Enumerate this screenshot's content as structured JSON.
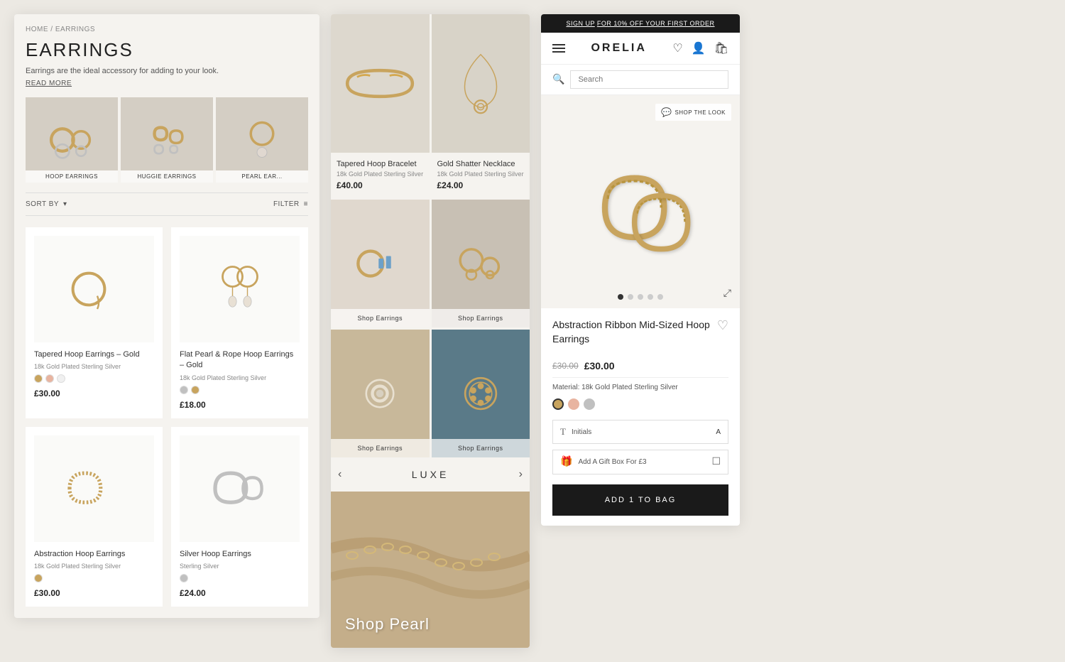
{
  "screen1": {
    "breadcrumb": "HOME / EARRINGS",
    "title": "EARRINGS",
    "description": "Earrings are the ideal accessory for adding to your look.",
    "read_more": "READ MORE",
    "categories": [
      {
        "label": "HOOP EARRINGS"
      },
      {
        "label": "HUGGIE EARRINGS"
      },
      {
        "label": "PEARL EAR..."
      }
    ],
    "sort_label": "SORT BY",
    "filter_label": "FILTER",
    "products": [
      {
        "name": "Tapered Hoop Earrings – Gold",
        "material": "18k Gold Plated Sterling Silver",
        "price": "£30.00",
        "swatches": [
          "gold",
          "rose",
          "white"
        ]
      },
      {
        "name": "Flat Pearl & Rope Hoop Earrings – Gold",
        "material": "18k Gold Plated Sterling Silver",
        "price": "£18.00",
        "swatches": [
          "silver",
          "gold"
        ]
      },
      {
        "name": "Abstraction Hoop Earrings",
        "material": "18k Gold Plated Sterling Silver",
        "price": "£30.00",
        "swatches": [
          "gold"
        ]
      },
      {
        "name": "Silver Hoop Earrings",
        "material": "Sterling Silver",
        "price": "£24.00",
        "swatches": [
          "silver"
        ]
      }
    ]
  },
  "screen2": {
    "featured_top_left": {
      "name": "Tapered Hoop Bracelet",
      "material": "18k Gold Plated Sterling Silver",
      "price": "£40.00"
    },
    "featured_top_right": {
      "name": "Gold Shatter Necklace",
      "material": "18k Gold Plated Sterling Silver",
      "price": "£24.00"
    },
    "grid_items": [
      {
        "label": "Shop Earrings"
      },
      {
        "label": "Shop Earrings"
      },
      {
        "label": "Shop Earrings"
      },
      {
        "label": "Shop Earrings"
      }
    ],
    "banner": {
      "title": "LUXE",
      "nav_left": "‹",
      "nav_right": "›"
    },
    "shop_pearl": {
      "label": "Shop Pearl"
    }
  },
  "screen3": {
    "promo": {
      "text": "FOR 10% OFF YOUR FIRST ORDER",
      "link": "SIGN UP"
    },
    "logo": "ORELIA",
    "search_placeholder": "Search",
    "shop_the_look": "SHOP THE LOOK",
    "product": {
      "name": "Abstraction Ribbon Mid-Sized Hoop Earrings",
      "price_old": "£30.00",
      "price_new": "£30.00",
      "material_label": "Material:",
      "material": "18k Gold Plated Sterling Silver",
      "swatches": [
        "gold",
        "rose",
        "silver"
      ],
      "initials_label": "Initials",
      "initials_value": "A",
      "gift_label": "Add A Gift Box For £3",
      "add_to_bag": "ADD 1 TO BAG",
      "wishlist_icon": "♡"
    },
    "image_dots": [
      true,
      false,
      false,
      false,
      false
    ]
  }
}
